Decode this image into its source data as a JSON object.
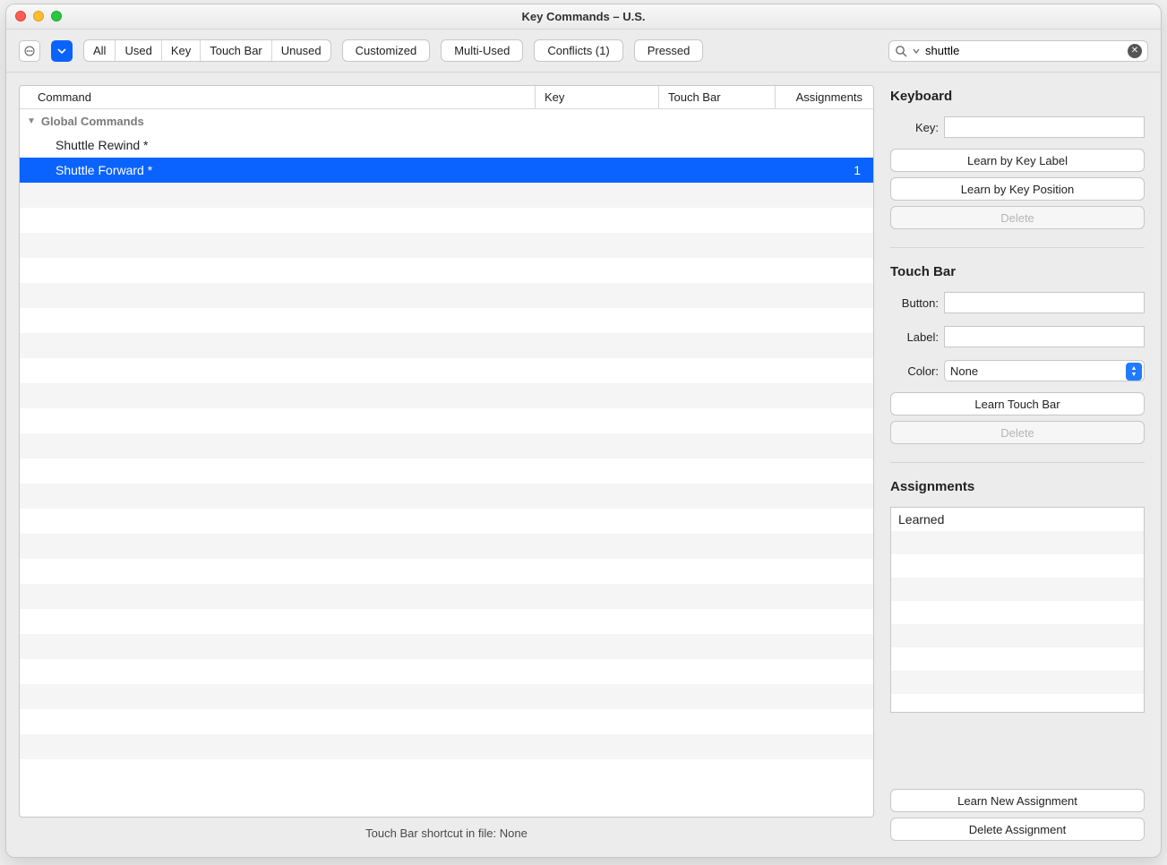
{
  "title": "Key Commands – U.S.",
  "toolbar": {
    "filters": [
      "All",
      "Used",
      "Key",
      "Touch Bar",
      "Unused"
    ],
    "customized": "Customized",
    "multiUsed": "Multi-Used",
    "conflicts": "Conflicts (1)",
    "pressed": "Pressed"
  },
  "search": {
    "value": "shuttle"
  },
  "table": {
    "headers": {
      "command": "Command",
      "key": "Key",
      "touch": "Touch Bar",
      "assign": "Assignments"
    },
    "group": "Global Commands",
    "rows": [
      {
        "command": "Shuttle Rewind *",
        "key": "",
        "touch": "",
        "assign": "",
        "selected": false
      },
      {
        "command": "Shuttle Forward *",
        "key": "",
        "touch": "",
        "assign": "1",
        "selected": true
      }
    ]
  },
  "status": "Touch Bar shortcut in file: None",
  "panel": {
    "keyboard": {
      "title": "Keyboard",
      "keyLabel": "Key:",
      "keyValue": "",
      "learnByLabel": "Learn by Key Label",
      "learnByPosition": "Learn by Key Position",
      "delete": "Delete"
    },
    "touchbar": {
      "title": "Touch Bar",
      "buttonLabel": "Button:",
      "buttonValue": "",
      "labelLabel": "Label:",
      "labelValue": "",
      "colorLabel": "Color:",
      "colorValue": "None",
      "learn": "Learn Touch Bar",
      "delete": "Delete"
    },
    "assignments": {
      "title": "Assignments",
      "items": [
        "Learned"
      ],
      "learnNew": "Learn New Assignment",
      "deleteAssign": "Delete Assignment"
    }
  }
}
